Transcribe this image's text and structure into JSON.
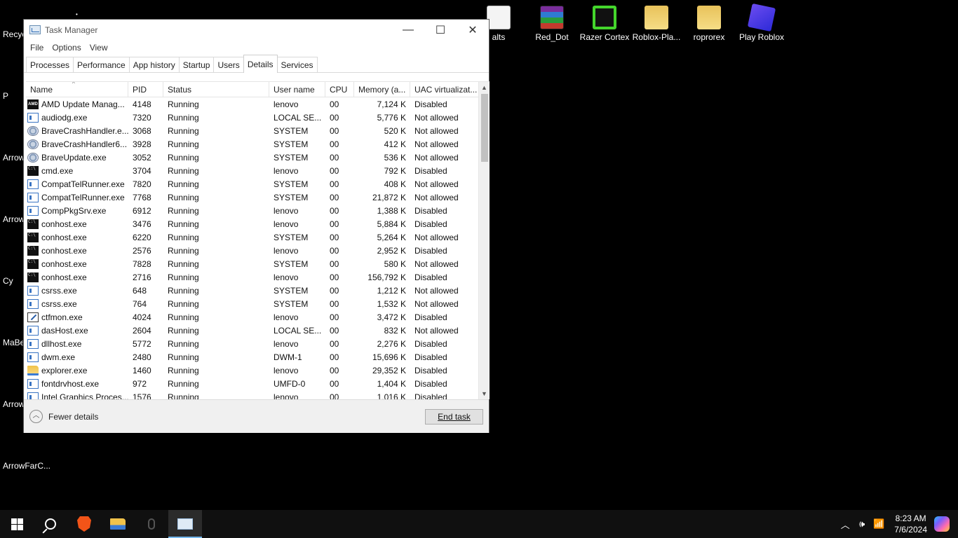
{
  "desktop": {
    "top_icons": [
      {
        "label": "alts",
        "kind": "doc"
      },
      {
        "label": "Red_Dot",
        "kind": "rar"
      },
      {
        "label": "Razer Cortex",
        "kind": "razer"
      },
      {
        "label": "Roblox-Pla...",
        "kind": "folder"
      },
      {
        "label": "roprorex",
        "kind": "folder"
      },
      {
        "label": "Play Roblox",
        "kind": "roblox"
      }
    ],
    "left_labels": [
      "Recyc",
      "P",
      "Arrow",
      "Arrow",
      "Cy",
      "MaBe",
      "Arrow",
      "ArrowFarC..."
    ]
  },
  "window": {
    "title": "Task Manager",
    "controls": {
      "minimize": "—",
      "maximize": "☐",
      "close": "✕"
    },
    "menu": [
      "File",
      "Options",
      "View"
    ],
    "tabs": [
      "Processes",
      "Performance",
      "App history",
      "Startup",
      "Users",
      "Details",
      "Services"
    ],
    "active_tab": "Details",
    "columns": [
      "Name",
      "PID",
      "Status",
      "User name",
      "CPU",
      "Memory (a...",
      "UAC virtualizat..."
    ],
    "rows": [
      {
        "icon": "amd",
        "name": "AMD Update Manag...",
        "pid": "4148",
        "status": "Running",
        "user": "lenovo",
        "cpu": "00",
        "mem": "7,124 K",
        "uac": "Disabled"
      },
      {
        "icon": "win",
        "name": "audiodg.exe",
        "pid": "7320",
        "status": "Running",
        "user": "LOCAL SE...",
        "cpu": "00",
        "mem": "5,776 K",
        "uac": "Not allowed"
      },
      {
        "icon": "gear",
        "name": "BraveCrashHandler.e...",
        "pid": "3068",
        "status": "Running",
        "user": "SYSTEM",
        "cpu": "00",
        "mem": "520 K",
        "uac": "Not allowed"
      },
      {
        "icon": "gear",
        "name": "BraveCrashHandler6...",
        "pid": "3928",
        "status": "Running",
        "user": "SYSTEM",
        "cpu": "00",
        "mem": "412 K",
        "uac": "Not allowed"
      },
      {
        "icon": "gear",
        "name": "BraveUpdate.exe",
        "pid": "3052",
        "status": "Running",
        "user": "SYSTEM",
        "cpu": "00",
        "mem": "536 K",
        "uac": "Not allowed"
      },
      {
        "icon": "cmd",
        "name": "cmd.exe",
        "pid": "3704",
        "status": "Running",
        "user": "lenovo",
        "cpu": "00",
        "mem": "792 K",
        "uac": "Disabled"
      },
      {
        "icon": "win",
        "name": "CompatTelRunner.exe",
        "pid": "7820",
        "status": "Running",
        "user": "SYSTEM",
        "cpu": "00",
        "mem": "408 K",
        "uac": "Not allowed"
      },
      {
        "icon": "win",
        "name": "CompatTelRunner.exe",
        "pid": "7768",
        "status": "Running",
        "user": "SYSTEM",
        "cpu": "00",
        "mem": "21,872 K",
        "uac": "Not allowed"
      },
      {
        "icon": "win",
        "name": "CompPkgSrv.exe",
        "pid": "6912",
        "status": "Running",
        "user": "lenovo",
        "cpu": "00",
        "mem": "1,388 K",
        "uac": "Disabled"
      },
      {
        "icon": "cmd",
        "name": "conhost.exe",
        "pid": "3476",
        "status": "Running",
        "user": "lenovo",
        "cpu": "00",
        "mem": "5,884 K",
        "uac": "Disabled"
      },
      {
        "icon": "cmd",
        "name": "conhost.exe",
        "pid": "6220",
        "status": "Running",
        "user": "SYSTEM",
        "cpu": "00",
        "mem": "5,264 K",
        "uac": "Not allowed"
      },
      {
        "icon": "cmd",
        "name": "conhost.exe",
        "pid": "2576",
        "status": "Running",
        "user": "lenovo",
        "cpu": "00",
        "mem": "2,952 K",
        "uac": "Disabled"
      },
      {
        "icon": "cmd",
        "name": "conhost.exe",
        "pid": "7828",
        "status": "Running",
        "user": "SYSTEM",
        "cpu": "00",
        "mem": "580 K",
        "uac": "Not allowed"
      },
      {
        "icon": "cmd",
        "name": "conhost.exe",
        "pid": "2716",
        "status": "Running",
        "user": "lenovo",
        "cpu": "00",
        "mem": "156,792 K",
        "uac": "Disabled"
      },
      {
        "icon": "win",
        "name": "csrss.exe",
        "pid": "648",
        "status": "Running",
        "user": "SYSTEM",
        "cpu": "00",
        "mem": "1,212 K",
        "uac": "Not allowed"
      },
      {
        "icon": "win",
        "name": "csrss.exe",
        "pid": "764",
        "status": "Running",
        "user": "SYSTEM",
        "cpu": "00",
        "mem": "1,532 K",
        "uac": "Not allowed"
      },
      {
        "icon": "pen",
        "name": "ctfmon.exe",
        "pid": "4024",
        "status": "Running",
        "user": "lenovo",
        "cpu": "00",
        "mem": "3,472 K",
        "uac": "Disabled"
      },
      {
        "icon": "win",
        "name": "dasHost.exe",
        "pid": "2604",
        "status": "Running",
        "user": "LOCAL SE...",
        "cpu": "00",
        "mem": "832 K",
        "uac": "Not allowed"
      },
      {
        "icon": "win",
        "name": "dllhost.exe",
        "pid": "5772",
        "status": "Running",
        "user": "lenovo",
        "cpu": "00",
        "mem": "2,276 K",
        "uac": "Disabled"
      },
      {
        "icon": "win",
        "name": "dwm.exe",
        "pid": "2480",
        "status": "Running",
        "user": "DWM-1",
        "cpu": "00",
        "mem": "15,696 K",
        "uac": "Disabled"
      },
      {
        "icon": "folder",
        "name": "explorer.exe",
        "pid": "1460",
        "status": "Running",
        "user": "lenovo",
        "cpu": "00",
        "mem": "29,352 K",
        "uac": "Disabled"
      },
      {
        "icon": "win",
        "name": "fontdrvhost.exe",
        "pid": "972",
        "status": "Running",
        "user": "UMFD-0",
        "cpu": "00",
        "mem": "1,404 K",
        "uac": "Disabled"
      },
      {
        "icon": "win",
        "name": "Intel Graphics Proces...",
        "pid": "1576",
        "status": "Running",
        "user": "lenovo",
        "cpu": "00",
        "mem": "1,016 K",
        "uac": "Disabled"
      }
    ],
    "fewer_details": "Fewer details",
    "end_task": "End task"
  },
  "taskbar": {
    "apps": [
      "start-icon",
      "search-icon",
      "brave-icon",
      "file-explorer-icon",
      "mouse-icon",
      "task-manager-icon"
    ],
    "time": "8:23 AM",
    "date": "7/6/2024"
  }
}
